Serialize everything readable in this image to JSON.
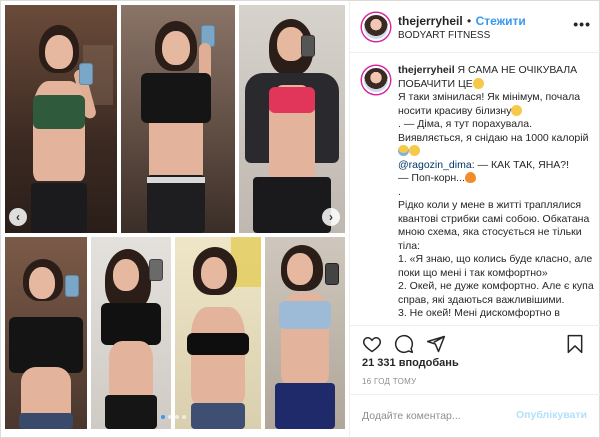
{
  "header": {
    "username": "thejerryheil",
    "separator": "•",
    "follow_label": "Стежити",
    "location": "BODYART FITNESS",
    "more_icon": "more-horizontal-icon"
  },
  "caption": {
    "username": "thejerryheil",
    "line1": "Я САМА НЕ ОЧІКУВАЛА ПОБАЧИТИ ЦЕ",
    "line2": "Я таки змінилася! Як мінімум, почала носити красиву білизну",
    "line3": ". — Діма, я тут порахувала. Виявляється, я снідаю на 1000 калорій",
    "mention": "@ragozin_dima",
    "line4_after_mention": ": — КАК ТАК, ЯНА?!",
    "line5": "— Поп-корн...",
    "line6": ".",
    "line7": "Рідко коли у мене в житті траплялися квантові стрибки самі собою. Обкатана мною схема, яка стосується не тільки тіла:",
    "line8": "1. «Я знаю, що колись буде класно, але поки що мені і так комфортно»",
    "line9": "2. Окей, не дуже комфортно. Але є купа справ, які здаються важливішими.",
    "line10": "3. Не окей! Мені дискомфортно в"
  },
  "actions": {
    "like_icon": "heart-icon",
    "comment_icon": "comment-icon",
    "share_icon": "share-icon",
    "save_icon": "bookmark-icon"
  },
  "likes_text": "21 331 вподобань",
  "timestamp": "16 ГОД ТОМУ",
  "comment": {
    "placeholder": "Додайте коментар...",
    "post_label": "Опублікувати"
  },
  "carousel": {
    "prev_icon": "chevron-left-icon",
    "next_icon": "chevron-right-icon",
    "slide_count": 4,
    "active_slide": 1
  },
  "colors": {
    "link_blue": "#3897f0",
    "text": "#262626",
    "muted": "#8e8e8e",
    "post_disabled": "#b2dffc"
  }
}
